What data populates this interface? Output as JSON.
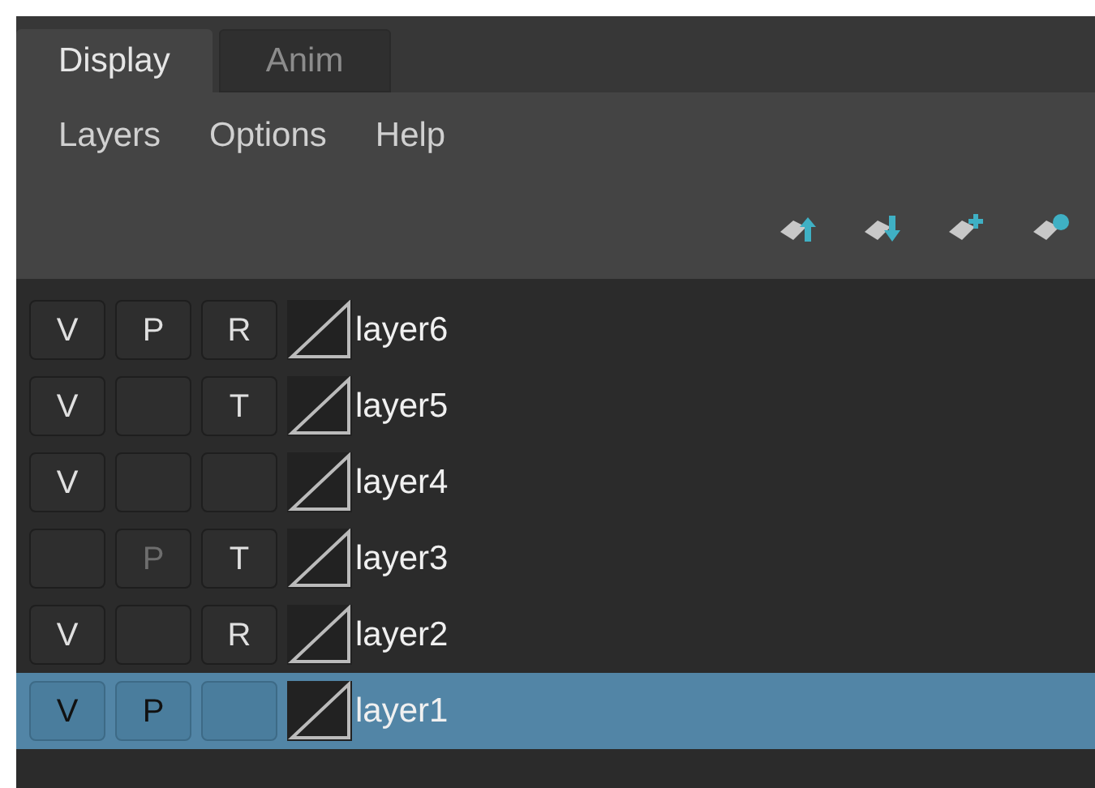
{
  "tabs": [
    {
      "label": "Display",
      "selected": true
    },
    {
      "label": "Anim",
      "selected": false
    }
  ],
  "menu": [
    "Layers",
    "Options",
    "Help"
  ],
  "toolbar": [
    {
      "kind": "up"
    },
    {
      "kind": "down"
    },
    {
      "kind": "add"
    },
    {
      "kind": "dot"
    }
  ],
  "layers": [
    {
      "name": "layer6",
      "selected": false,
      "toggles": [
        {
          "kind": "letter",
          "label": "V",
          "dimmed": false
        },
        {
          "kind": "letter",
          "label": "P",
          "dimmed": false
        },
        {
          "kind": "letter",
          "label": "R",
          "dimmed": false
        }
      ]
    },
    {
      "name": "layer5",
      "selected": false,
      "toggles": [
        {
          "kind": "letter",
          "label": "V",
          "dimmed": false
        },
        {
          "kind": "blank"
        },
        {
          "kind": "letter",
          "label": "T",
          "dimmed": false
        }
      ]
    },
    {
      "name": "layer4",
      "selected": false,
      "toggles": [
        {
          "kind": "letter",
          "label": "V",
          "dimmed": false
        },
        {
          "kind": "blank"
        },
        {
          "kind": "blank"
        }
      ]
    },
    {
      "name": "layer3",
      "selected": false,
      "toggles": [
        {
          "kind": "blank"
        },
        {
          "kind": "letter",
          "label": "P",
          "dimmed": true
        },
        {
          "kind": "letter",
          "label": "T",
          "dimmed": false
        }
      ]
    },
    {
      "name": "layer2",
      "selected": false,
      "toggles": [
        {
          "kind": "letter",
          "label": "V",
          "dimmed": false
        },
        {
          "kind": "blank"
        },
        {
          "kind": "letter",
          "label": "R",
          "dimmed": false
        }
      ]
    },
    {
      "name": "layer1",
      "selected": true,
      "toggles": [
        {
          "kind": "letter",
          "label": "V",
          "dimmed": false
        },
        {
          "kind": "letter",
          "label": "P",
          "dimmed": false
        },
        {
          "kind": "blank"
        }
      ]
    }
  ]
}
